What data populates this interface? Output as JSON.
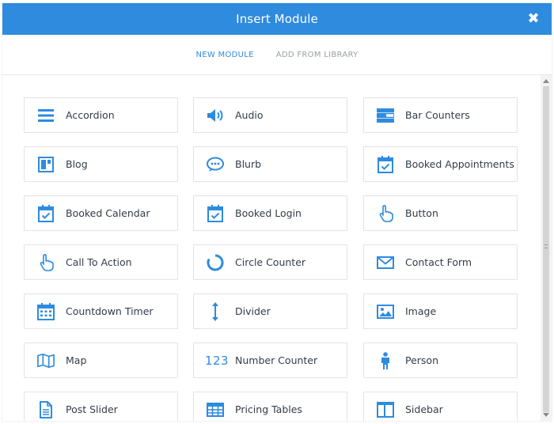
{
  "dialog": {
    "title": "Insert Module",
    "close_glyph": "✖"
  },
  "tabs": [
    {
      "label": "NEW MODULE",
      "active": true
    },
    {
      "label": "ADD FROM LIBRARY",
      "active": false
    }
  ],
  "modules": [
    {
      "label": "Accordion",
      "icon": "accordion-icon"
    },
    {
      "label": "Audio",
      "icon": "audio-icon"
    },
    {
      "label": "Bar Counters",
      "icon": "bar-counters-icon"
    },
    {
      "label": "Blog",
      "icon": "blog-icon"
    },
    {
      "label": "Blurb",
      "icon": "blurb-icon"
    },
    {
      "label": "Booked Appointments",
      "icon": "calendar-check-icon"
    },
    {
      "label": "Booked Calendar",
      "icon": "calendar-check-icon"
    },
    {
      "label": "Booked Login",
      "icon": "calendar-check-icon"
    },
    {
      "label": "Button",
      "icon": "pointer-icon"
    },
    {
      "label": "Call To Action",
      "icon": "pointer-icon"
    },
    {
      "label": "Circle Counter",
      "icon": "circle-counter-icon"
    },
    {
      "label": "Contact Form",
      "icon": "envelope-icon"
    },
    {
      "label": "Countdown Timer",
      "icon": "calendar-grid-icon"
    },
    {
      "label": "Divider",
      "icon": "divider-icon"
    },
    {
      "label": "Image",
      "icon": "image-icon"
    },
    {
      "label": "Map",
      "icon": "map-icon"
    },
    {
      "label": "Number Counter",
      "icon": "number-counter-icon",
      "icon_text": "123"
    },
    {
      "label": "Person",
      "icon": "person-icon"
    },
    {
      "label": "Post Slider",
      "icon": "document-icon"
    },
    {
      "label": "Pricing Tables",
      "icon": "table-icon"
    },
    {
      "label": "Sidebar",
      "icon": "sidebar-icon"
    }
  ],
  "colors": {
    "accent": "#2e8bde",
    "text": "#333c48",
    "border": "#dfe3e8",
    "inactive_tab": "#9aa0a6"
  }
}
